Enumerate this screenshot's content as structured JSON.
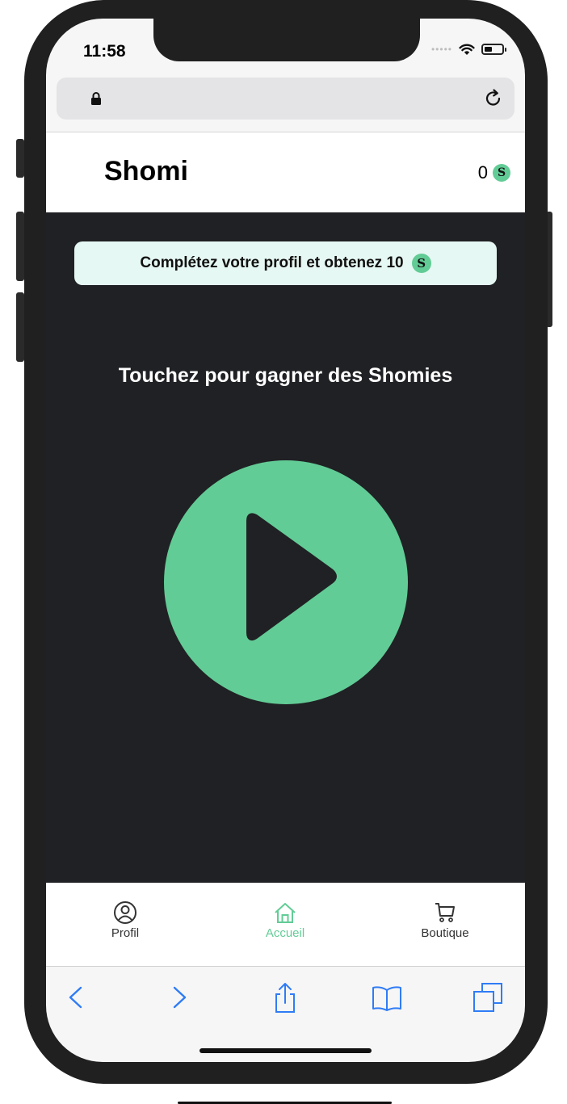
{
  "status_bar": {
    "time": "11:58"
  },
  "app": {
    "brand": "Shomi",
    "balance": "0",
    "coin_symbol": "S"
  },
  "banner": {
    "text": "Complétez votre profil et obtenez 10"
  },
  "main": {
    "subtitle": "Touchez pour gagner des Shomies"
  },
  "tabs": [
    {
      "label": "Profil",
      "icon": "user-circle-icon",
      "active": false
    },
    {
      "label": "Accueil",
      "icon": "home-icon",
      "active": true
    },
    {
      "label": "Boutique",
      "icon": "cart-icon",
      "active": false
    }
  ],
  "colors": {
    "accent": "#62cc96",
    "banner_bg": "#e6f8f3",
    "dark_bg": "#202124",
    "ios_blue": "#2f7cf6"
  }
}
